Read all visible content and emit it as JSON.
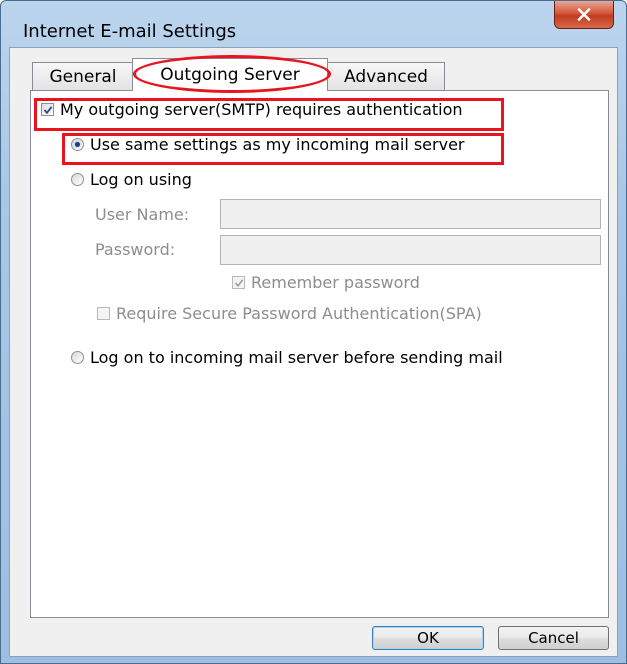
{
  "window": {
    "title": "Internet E-mail Settings"
  },
  "tabs": [
    {
      "label": "General"
    },
    {
      "label": "Outgoing Server"
    },
    {
      "label": "Advanced"
    }
  ],
  "outgoing": {
    "smtp_auth_label": "My outgoing server(SMTP) requires authentication",
    "use_same_label": "Use same settings as my incoming mail server",
    "log_on_using_label": "Log on using",
    "user_name_label": "User Name:",
    "user_name_value": "",
    "password_label": "Password:",
    "password_value": "",
    "remember_password_label": "Remember password",
    "spa_label": "Require Secure Password Authentication(SPA)",
    "log_on_incoming_label": "Log on to incoming mail server before sending mail"
  },
  "buttons": {
    "ok": "OK",
    "cancel": "Cancel"
  },
  "colors": {
    "annotation": "#e8141e",
    "title_bar": "#a9c7e6",
    "close_button": "#c23b1f"
  }
}
